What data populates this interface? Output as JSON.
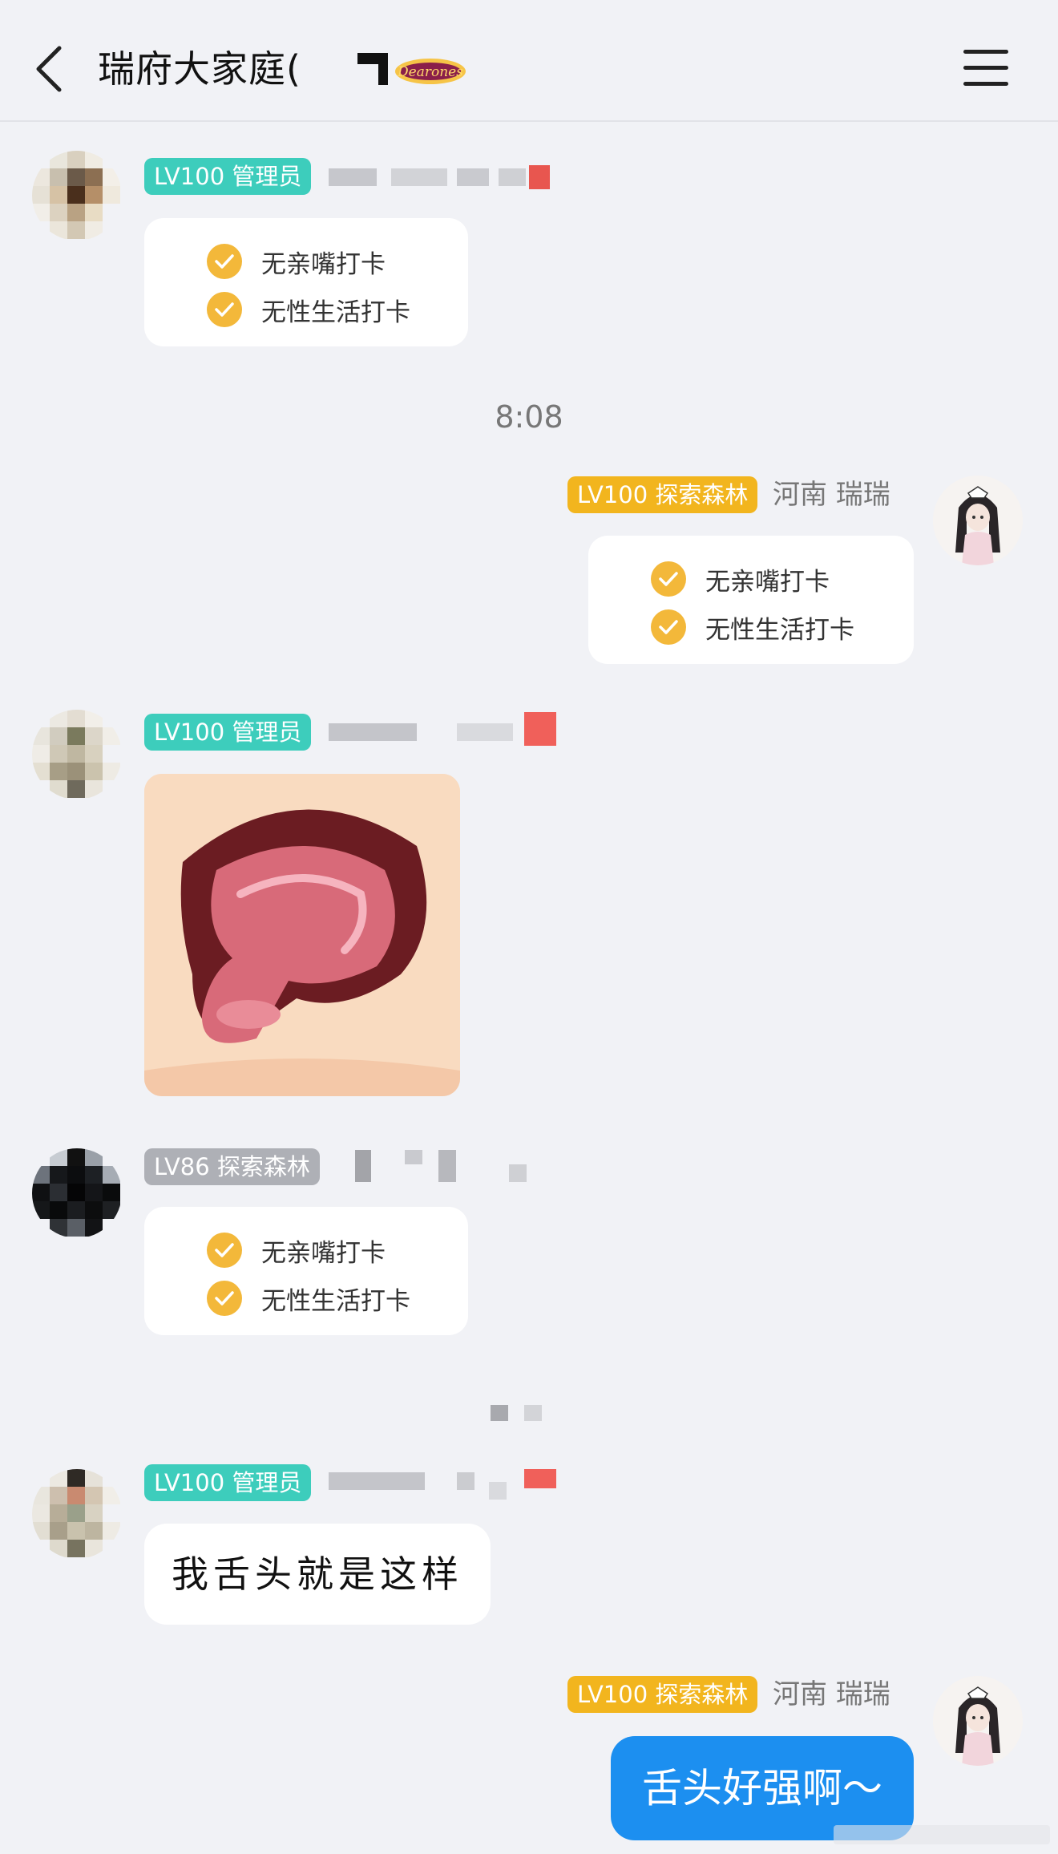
{
  "header": {
    "title": "瑞府大家庭(",
    "back_icon": "chevron-left-icon",
    "menu_icon": "hamburger-menu-icon",
    "title_logo_text": "Dearones"
  },
  "check_items": [
    "无亲嘴打卡",
    "无性生活打卡"
  ],
  "messages": [
    {
      "side": "left",
      "tag": "LV100 管理员",
      "tag_color": "#3dcdbc",
      "type": "checkin"
    },
    {
      "side": "right",
      "tag": "LV100 探索森林",
      "tag_color": "#f2b51e",
      "name": "河南 瑞瑞",
      "type": "checkin"
    },
    {
      "side": "left",
      "tag": "LV100 管理员",
      "tag_color": "#3dcdbc",
      "type": "sticker"
    },
    {
      "side": "left",
      "tag": "LV86 探索森林",
      "tag_color": "#aeb0b6",
      "type": "checkin"
    },
    {
      "side": "left",
      "tag": "LV100 管理员",
      "tag_color": "#3dcdbc",
      "type": "text",
      "text": "我舌头就是这样"
    },
    {
      "side": "right",
      "tag": "LV100 探索森林",
      "tag_color": "#f2b51e",
      "name": "河南 瑞瑞",
      "type": "text",
      "text": "舌头好强啊～"
    }
  ],
  "time_divider": "8:08",
  "colors": {
    "background": "#f1f2f6",
    "own_bubble": "#1c8ff0",
    "check_icon": "#f3b83a"
  }
}
